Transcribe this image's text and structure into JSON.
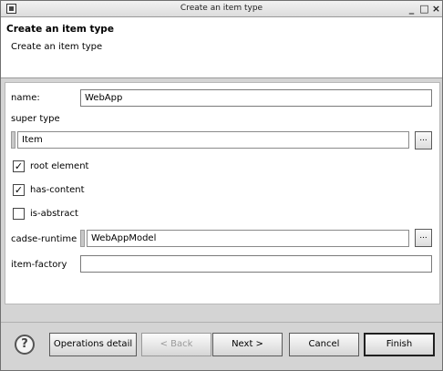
{
  "window": {
    "title": "Create an item type",
    "controls": [
      "_",
      "□",
      "×"
    ]
  },
  "banner": {
    "title": "Create an item type",
    "message": "Create an item type"
  },
  "form": {
    "name_label": "name:",
    "name_value": "WebApp",
    "super_type_label": "super type",
    "super_type_value": "Item",
    "browse_label": "...",
    "root_element": {
      "label": "root element",
      "checked": true,
      "mark": "✓"
    },
    "has_content": {
      "label": "has-content",
      "checked": true,
      "mark": "✓"
    },
    "is_abstract": {
      "label": "is-abstract",
      "checked": false,
      "mark": ""
    },
    "cadse_runtime_label": "cadse-runtime",
    "cadse_runtime_value": "WebAppModel",
    "item_factory_label": "item-factory",
    "item_factory_value": ""
  },
  "footer": {
    "help": "?",
    "operations_detail": "Operations detail",
    "back": "< Back",
    "next": "Next >",
    "cancel": "Cancel",
    "finish": "Finish"
  }
}
